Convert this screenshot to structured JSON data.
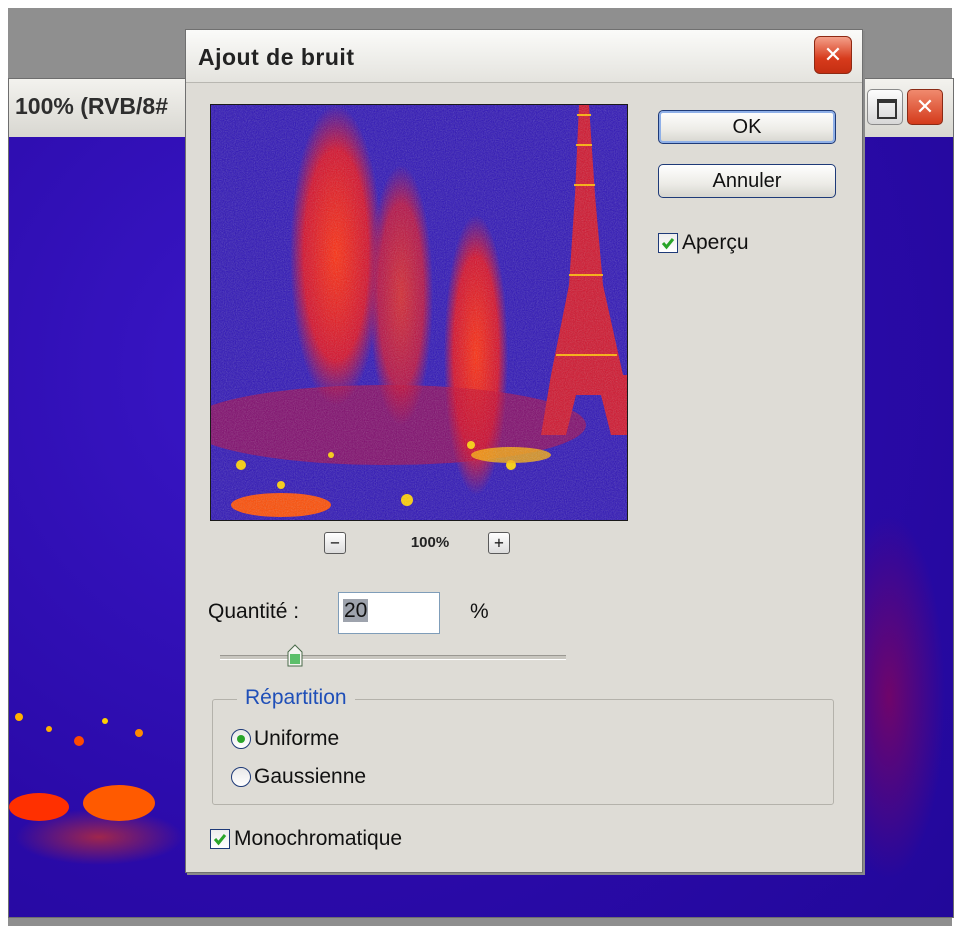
{
  "document": {
    "title": "100% (RVB/8#"
  },
  "dialog": {
    "title": "Ajout de bruit",
    "buttons": {
      "ok": "OK",
      "cancel": "Annuler"
    },
    "preview_checkbox": {
      "label": "Aperçu",
      "checked": true
    },
    "zoom": {
      "level": "100%",
      "minus": "−",
      "plus": "+"
    },
    "amount": {
      "label": "Quantité :",
      "value": "20",
      "unit": "%",
      "slider_value_percent": 20
    },
    "distribution": {
      "legend": "Répartition",
      "options": [
        {
          "label": "Uniforme",
          "selected": true
        },
        {
          "label": "Gaussienne",
          "selected": false
        }
      ]
    },
    "mono_checkbox": {
      "label": "Monochromatique",
      "checked": true
    }
  },
  "colors": {
    "check_green": "#2aa52a",
    "legend_blue": "#1f4fb8",
    "close_red": "#d43a1b",
    "image_blue": "#2b10b6",
    "image_red": "#e0100a"
  },
  "icons": {
    "close": "close-icon",
    "maximize": "maximize-icon",
    "check": "checkmark-icon"
  }
}
